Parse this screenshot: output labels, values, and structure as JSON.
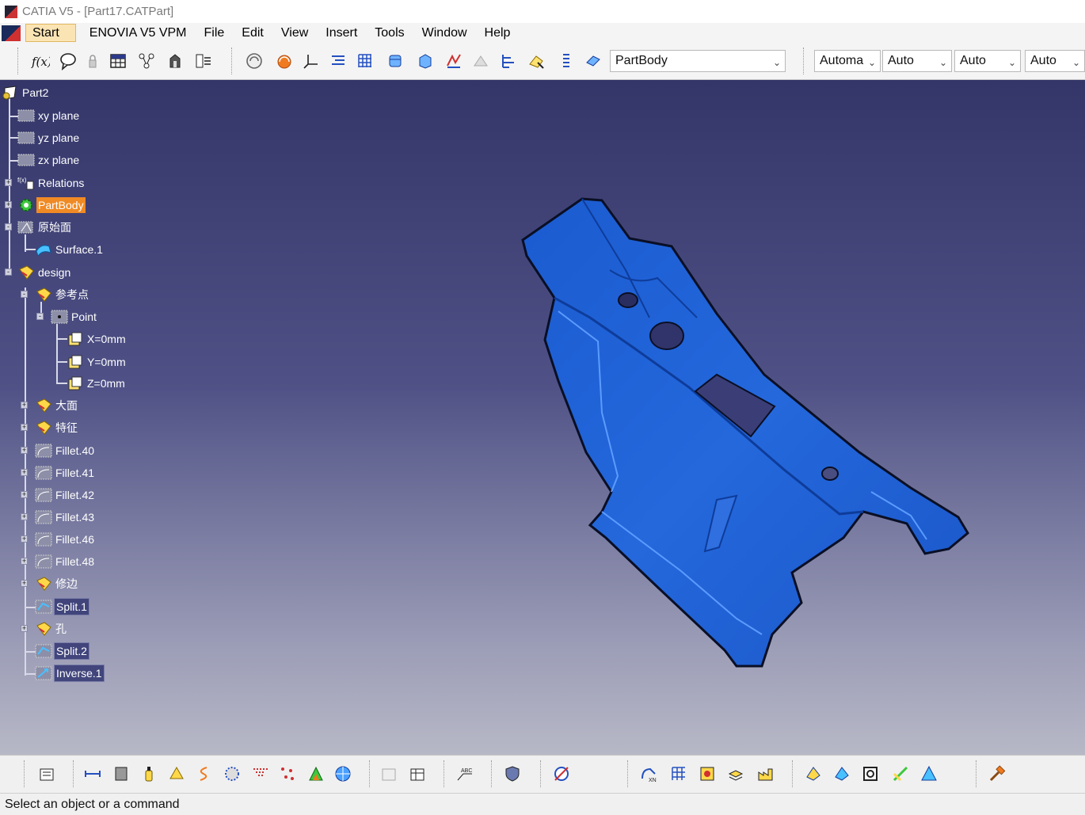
{
  "window": {
    "title": "CATIA V5 - [Part17.CATPart]"
  },
  "menu": {
    "start": "Start",
    "enovia": "ENOVIA V5 VPM",
    "file": "File",
    "edit": "Edit",
    "view": "View",
    "insert": "Insert",
    "tools": "Tools",
    "window": "Window",
    "help": "Help"
  },
  "toolbar": {
    "work_object": "PartBody",
    "combo1": "Automa",
    "combo2": "Auto",
    "combo3": "Auto",
    "combo4": "Auto"
  },
  "tree": {
    "root": "Part2",
    "xy_plane": "xy plane",
    "yz_plane": "yz plane",
    "zx_plane": "zx plane",
    "relations": "Relations",
    "partbody": "PartBody",
    "raw_surface_set": "原始面",
    "surface1": "Surface.1",
    "design": "design",
    "reference_points": "参考点",
    "point": "Point",
    "x": "X=0mm",
    "y": "Y=0mm",
    "z": "Z=0mm",
    "big_face": "大面",
    "feature": "特征",
    "fillet40": "Fillet.40",
    "fillet41": "Fillet.41",
    "fillet42": "Fillet.42",
    "fillet43": "Fillet.43",
    "fillet46": "Fillet.46",
    "fillet48": "Fillet.48",
    "trim": "修边",
    "split1": "Split.1",
    "hole": "孔",
    "split2": "Split.2",
    "inverse1": "Inverse.1"
  },
  "colors": {
    "model": "#1f63d6",
    "selected": "#f08a24"
  },
  "status": {
    "prompt": "Select an object or a command"
  }
}
